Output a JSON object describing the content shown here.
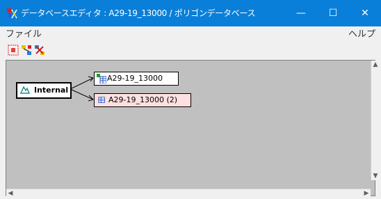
{
  "window": {
    "title": "データベースエディタ : A29-19_13000 / ポリゴンデータベース",
    "controls": {
      "minimize": "—",
      "maximize": "☐",
      "close": "✕"
    }
  },
  "menu": {
    "file": "ファイル",
    "help": "ヘルプ"
  },
  "graph": {
    "nodes": {
      "internal": "Internal",
      "table_a": "A29-19_13000",
      "table_b": "A29-19_13000 (2)"
    }
  },
  "icons": {
    "app": "database-editor-icon",
    "toolbar": [
      "node-tool-icon",
      "link-tool-icon",
      "unlink-tool-icon"
    ],
    "internal": "internal-db-icon",
    "table_a": "table-icon",
    "table_b": "table-icon"
  }
}
